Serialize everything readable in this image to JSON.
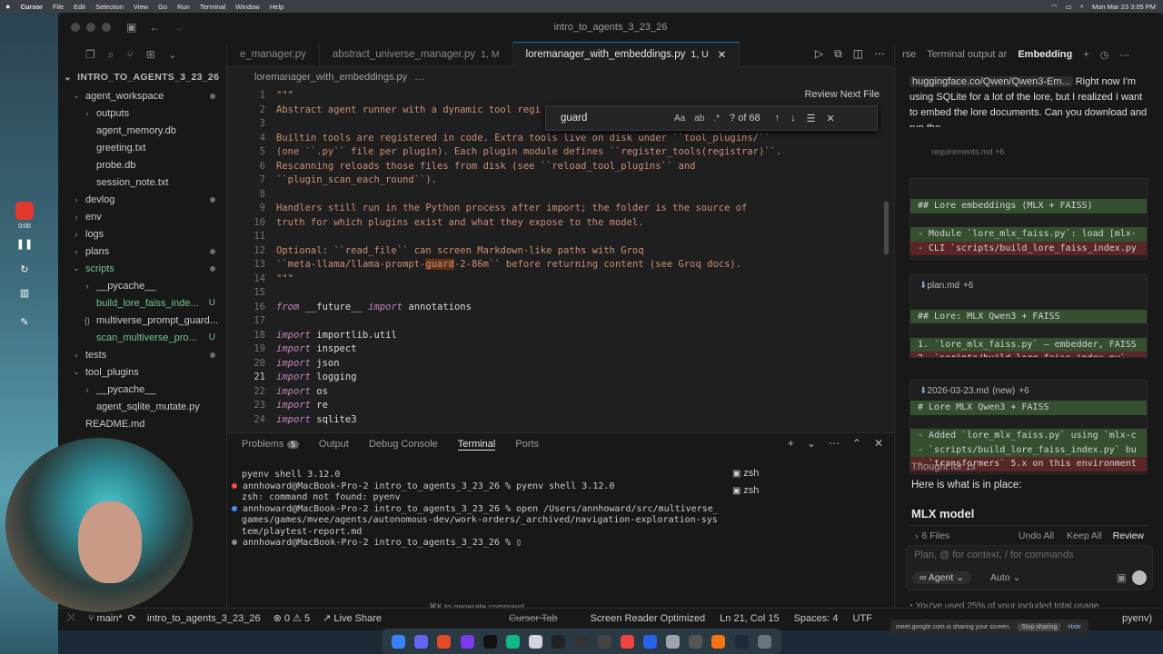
{
  "menubar": {
    "apple": "",
    "app": "Cursor",
    "items": [
      "File",
      "Edit",
      "Selection",
      "View",
      "Go",
      "Run",
      "Terminal",
      "Window",
      "Help"
    ],
    "clock": "Mon Mar 23 3:05 PM"
  },
  "window": {
    "title": "intro_to_agents_3_23_26"
  },
  "recorder": {
    "time": "0:00"
  },
  "sidebar": {
    "root": "INTRO_TO_AGENTS_3_23_26",
    "items": [
      {
        "label": "agent_workspace",
        "depth": 0,
        "chev": "⌄",
        "dot": true
      },
      {
        "label": "outputs",
        "depth": 1,
        "chev": "›"
      },
      {
        "label": "agent_memory.db",
        "depth": 1,
        "chev": ""
      },
      {
        "label": "greeting.txt",
        "depth": 1,
        "chev": ""
      },
      {
        "label": "probe.db",
        "depth": 1,
        "chev": ""
      },
      {
        "label": "session_note.txt",
        "depth": 1,
        "chev": ""
      },
      {
        "label": "devlog",
        "depth": 0,
        "chev": "›",
        "dot": true
      },
      {
        "label": "env",
        "depth": 0,
        "chev": "›"
      },
      {
        "label": "logs",
        "depth": 0,
        "chev": "›"
      },
      {
        "label": "plans",
        "depth": 0,
        "chev": "›",
        "dot": true
      },
      {
        "label": "scripts",
        "depth": 0,
        "chev": "⌄",
        "dot": true,
        "git": true
      },
      {
        "label": "__pycache__",
        "depth": 1,
        "chev": "›"
      },
      {
        "label": "build_lore_faiss_inde...",
        "depth": 1,
        "chev": "",
        "u": "U",
        "git": true
      },
      {
        "label": "multiverse_prompt_guard...",
        "depth": 1,
        "chev": "{}"
      },
      {
        "label": "scan_multiverse_pro...",
        "depth": 1,
        "chev": "",
        "u": "U",
        "git": true
      },
      {
        "label": "tests",
        "depth": 0,
        "chev": "›",
        "dot": true
      },
      {
        "label": "tool_plugins",
        "depth": 0,
        "chev": "⌄"
      },
      {
        "label": "__pycache__",
        "depth": 1,
        "chev": "›"
      },
      {
        "label": "agent_sqlite_mutate.py",
        "depth": 1,
        "chev": ""
      },
      {
        "label": "README.md",
        "depth": 0,
        "chev": ""
      }
    ],
    "lower_badges": [
      "M",
      "M",
      "U",
      "1, U",
      "M"
    ]
  },
  "editor": {
    "tabs": [
      {
        "label": "e_manager.py",
        "mod": ""
      },
      {
        "label": "abstract_universe_manager.py",
        "mod": "1, M"
      },
      {
        "label": "loremanager_with_embeddings.py",
        "mod": "1, U",
        "active": true
      }
    ],
    "breadcrumb": "loremanager_with_embeddings.py",
    "breadcrumb_more": "…",
    "review_label": "Review Next File",
    "find": {
      "query": "guard",
      "count": "? of 68",
      "case": "Aa",
      "word": "ab",
      "regex": ".*"
    },
    "lines": [
      {
        "n": "1",
        "text": "\"\"\"",
        "cls": "cm"
      },
      {
        "n": "2",
        "text": "Abstract agent runner with a dynamic tool regi",
        "cls": "cm"
      },
      {
        "n": "3",
        "text": "",
        "cls": "cm"
      },
      {
        "n": "4",
        "text": "Builtin tools are registered in code. Extra tools live on disk under ``tool_plugins/``",
        "cls": "cm"
      },
      {
        "n": "5",
        "text": "(one ``.py`` file per plugin). Each plugin module defines ``register_tools(registrar)``.",
        "cls": "cm"
      },
      {
        "n": "6",
        "text": "Rescanning reloads those files from disk (see ``reload_tool_plugins`` and",
        "cls": "cm"
      },
      {
        "n": "7",
        "text": "``plugin_scan_each_round``).",
        "cls": "cm"
      },
      {
        "n": "8",
        "text": "",
        "cls": "cm"
      },
      {
        "n": "9",
        "text": "Handlers still run in the Python process after import; the folder is the source of",
        "cls": "cm"
      },
      {
        "n": "10",
        "text": "truth for which plugins exist and what they expose to the model.",
        "cls": "cm"
      },
      {
        "n": "11",
        "text": "",
        "cls": "cm"
      },
      {
        "n": "12",
        "text": "Optional: ``read_file`` can screen Markdown-like paths with Groq",
        "cls": "cm"
      },
      {
        "n": "13",
        "pre": "``meta-llama/llama-prompt-",
        "mark": "guard",
        "post": "-2-86m`` before returning content (see Groq docs).",
        "cls": "cm"
      },
      {
        "n": "14",
        "text": "\"\"\"",
        "cls": "cm"
      },
      {
        "n": "15",
        "text": "",
        "cls": "cm"
      },
      {
        "n": "16",
        "kw": "from",
        "rest": " __future__ ",
        "kw2": "import",
        "rest2": " annotations"
      },
      {
        "n": "17",
        "text": "",
        "cls": "cm"
      },
      {
        "n": "18",
        "kw": "import",
        "rest": " importlib.util"
      },
      {
        "n": "19",
        "kw": "import",
        "rest": " inspect"
      },
      {
        "n": "20",
        "kw": "import",
        "rest": " json"
      },
      {
        "n": "21",
        "kw": "import",
        "rest": " logging",
        "current": true
      },
      {
        "n": "22",
        "kw": "import",
        "rest": " os"
      },
      {
        "n": "23",
        "kw": "import",
        "rest": " re"
      },
      {
        "n": "24",
        "kw": "import",
        "rest": " sqlite3"
      }
    ]
  },
  "panel": {
    "tabs": [
      "Problems",
      "Output",
      "Debug Console",
      "Terminal",
      "Ports"
    ],
    "problems_count": "5",
    "terminal": [
      {
        "dot": "",
        "text": "pyenv shell 3.12.0"
      },
      {
        "dot": "red",
        "text": "annhoward@MacBook-Pro-2 intro_to_agents_3_23_26 % pyenv shell 3.12.0"
      },
      {
        "dot": "",
        "text": "zsh: command not found: pyenv"
      },
      {
        "dot": "blue",
        "text": "annhoward@MacBook-Pro-2 intro_to_agents_3_23_26 % open /Users/annhoward/src/multiverse_"
      },
      {
        "dot": "",
        "text": "games/games/mvee/agents/autonomous-dev/work-orders/_archived/navigation-exploration-sys"
      },
      {
        "dot": "",
        "text": "tem/playtest-report.md"
      },
      {
        "dot": "grey",
        "text": "annhoward@MacBook-Pro-2 intro_to_agents_3_23_26 % ▯"
      }
    ],
    "shells": [
      "zsh",
      "zsh"
    ],
    "hint": "⌘K to generate command"
  },
  "ai": {
    "tabs": [
      "rse",
      "Terminal output ar",
      "Embedding"
    ],
    "message": {
      "link": "huggingface.co/Qwen/Qwen3-Em...",
      "text": " Right now I'm using SQLite for a lot of the lore, but I realized I want to embed the lore documents. Can you download and run the"
    },
    "faded": "requirements.md  +6",
    "cards": [
      {
        "file": "",
        "lines": [
          {
            "t": "## Lore embeddings (MLX + FAISS)",
            "c": "hl"
          },
          {
            "t": "",
            "c": ""
          },
          {
            "t": "- Module `lore_mlx_faiss.py`: load [mlx-",
            "c": "hl"
          },
          {
            "t": "- CLI `scripts/build_lore_faiss_index.py",
            "c": "hr"
          }
        ]
      },
      {
        "file": "plan.md",
        "plus": "+6",
        "lines": [
          {
            "t": "",
            "c": ""
          },
          {
            "t": "## Lore: MLX Qwen3 + FAISS",
            "c": "hl"
          },
          {
            "t": "",
            "c": ""
          },
          {
            "t": "1. `lore_mlx_faiss.py` — embedder, FAISS",
            "c": "hl"
          },
          {
            "t": "2. `scripts/build_lore_faiss_index.py` —",
            "c": "hr"
          }
        ]
      },
      {
        "file": "2026-03-23.md",
        "new": "(new)",
        "plus": "+6",
        "lines": [
          {
            "t": "# Lore MLX Qwen3 + FAISS",
            "c": "hl"
          },
          {
            "t": "",
            "c": ""
          },
          {
            "t": "- Added `lore_mlx_faiss.py` using `mlx-c",
            "c": "hl"
          },
          {
            "t": "- `scripts/build_lore_faiss_index.py` bu",
            "c": "hl"
          },
          {
            "t": "- `transformers` 5.x on this environment",
            "c": "hr"
          }
        ]
      }
    ],
    "thought": "Thought for 1s",
    "here": "Here is what is in place:",
    "heading": "MLX model",
    "files": "6 Files",
    "undo": "Undo All",
    "keep": "Keep All",
    "review": "Review",
    "input_placeholder": "Plan, @ for context, / for commands",
    "mode": "Agent",
    "model": "Auto",
    "usage": "You've used 25% of your included total usage"
  },
  "status": {
    "branch": "main*",
    "sync": "⟳",
    "workspace": "intro_to_agents_3_23_26",
    "errors": "0",
    "warnings": "5",
    "live": "Live Share",
    "cursor_tab": "Cursor Tab",
    "sr": "Screen Reader Optimized",
    "pos": "Ln 21, Col 15",
    "spaces": "Spaces: 4",
    "enc": "UTF",
    "lang": "pyenv)"
  },
  "share": {
    "text": "meet.google.com is sharing your screen.",
    "stop": "Stop sharing",
    "hide": "Hide"
  }
}
